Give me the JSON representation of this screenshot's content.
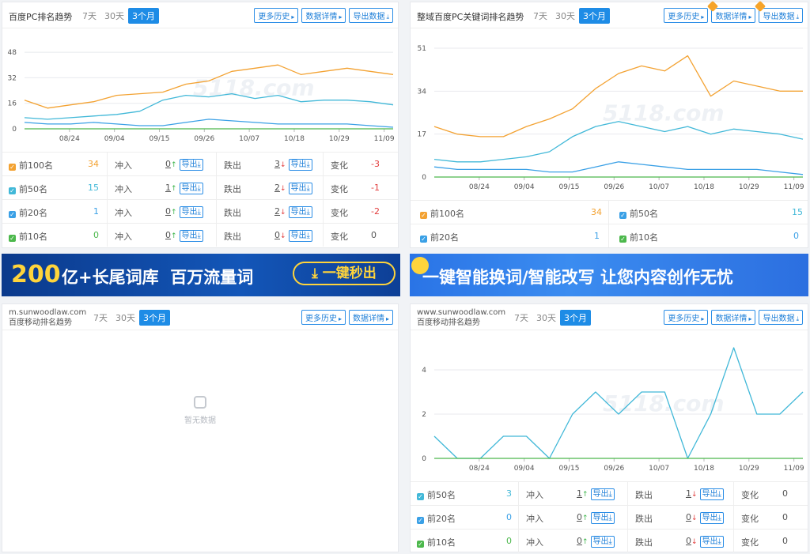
{
  "tabs": [
    "7天",
    "30天",
    "3个月"
  ],
  "head_buttons": [
    "更多历史",
    "数据详情",
    "导出数据"
  ],
  "export_label": "导出",
  "xticks": [
    "08/24",
    "09/04",
    "09/15",
    "09/26",
    "10/07",
    "10/18",
    "10/29",
    "11/09"
  ],
  "colors": {
    "orange": "#f3a232",
    "blue": "#3aa0e6",
    "cyan": "#41b8d8",
    "green": "#4cb84c",
    "accent": "#1e8ce6"
  },
  "panel1": {
    "title": "百度PC排名趋势",
    "yticks": [
      "0",
      "16",
      "32",
      "48"
    ],
    "rows": [
      {
        "label": "前100名",
        "value": "34",
        "in_label": "冲入",
        "in": "0",
        "out_label": "跌出",
        "out": "3",
        "chg_label": "变化",
        "chg": "-3"
      },
      {
        "label": "前50名",
        "value": "15",
        "in_label": "冲入",
        "in": "1",
        "out_label": "跌出",
        "out": "2",
        "chg_label": "变化",
        "chg": "-1"
      },
      {
        "label": "前20名",
        "value": "1",
        "in_label": "冲入",
        "in": "0",
        "out_label": "跌出",
        "out": "2",
        "chg_label": "变化",
        "chg": "-2"
      },
      {
        "label": "前10名",
        "value": "0",
        "in_label": "冲入",
        "in": "0",
        "out_label": "跌出",
        "out": "0",
        "chg_label": "变化",
        "chg": "0"
      }
    ]
  },
  "panel2": {
    "title": "整域百度PC关键词排名趋势",
    "yticks": [
      "0",
      "17",
      "34",
      "51"
    ],
    "stats": [
      {
        "label": "前100名",
        "value": "34"
      },
      {
        "label": "前50名",
        "value": "15"
      },
      {
        "label": "前20名",
        "value": "1"
      },
      {
        "label": "前10名",
        "value": "0"
      }
    ]
  },
  "banner1": {
    "num": "200",
    "text": "亿+长尾词库  百万流量词",
    "btn": "一键秒出"
  },
  "banner2": {
    "text": "一键智能换词/智能改写 让您内容创作无忧"
  },
  "panel3": {
    "domain": "m.sunwoodlaw.com",
    "subtitle": "百度移动排名趋势",
    "nodata": "暂无数据"
  },
  "panel4": {
    "domain": "www.sunwoodlaw.com",
    "subtitle": "百度移动排名趋势",
    "yticks": [
      "0",
      "2",
      "4"
    ],
    "rows": [
      {
        "label": "前50名",
        "value": "3",
        "in_label": "冲入",
        "in": "1",
        "out_label": "跌出",
        "out": "1",
        "chg_label": "变化",
        "chg": "0"
      },
      {
        "label": "前20名",
        "value": "0",
        "in_label": "冲入",
        "in": "0",
        "out_label": "跌出",
        "out": "0",
        "chg_label": "变化",
        "chg": "0"
      },
      {
        "label": "前10名",
        "value": "0",
        "in_label": "冲入",
        "in": "0",
        "out_label": "跌出",
        "out": "0",
        "chg_label": "变化",
        "chg": "0"
      }
    ]
  },
  "chart_data": [
    {
      "type": "line",
      "x": [
        "08/14",
        "08/19",
        "08/24",
        "08/29",
        "09/04",
        "09/09",
        "09/15",
        "09/20",
        "09/26",
        "10/01",
        "10/07",
        "10/12",
        "10/18",
        "10/23",
        "10/29",
        "11/03",
        "11/09"
      ],
      "ylim": [
        0,
        52
      ],
      "series": [
        {
          "color": "#f3a232",
          "values": [
            18,
            13,
            15,
            17,
            21,
            22,
            23,
            28,
            30,
            36,
            38,
            40,
            34,
            36,
            38,
            36,
            34
          ]
        },
        {
          "color": "#41b8d8",
          "values": [
            7,
            6,
            7,
            8,
            9,
            11,
            18,
            21,
            20,
            22,
            19,
            21,
            17,
            18,
            18,
            17,
            15
          ]
        },
        {
          "color": "#3aa0e6",
          "values": [
            4,
            3,
            3,
            4,
            3,
            2,
            2,
            4,
            6,
            5,
            4,
            3,
            3,
            3,
            3,
            2,
            1
          ]
        },
        {
          "color": "#4cb84c",
          "values": [
            0,
            0,
            0,
            0,
            0,
            0,
            0,
            0,
            0,
            0,
            0,
            0,
            0,
            0,
            0,
            0,
            0
          ]
        }
      ]
    },
    {
      "type": "line",
      "x": [
        "08/14",
        "08/19",
        "08/24",
        "08/29",
        "09/04",
        "09/09",
        "09/15",
        "09/20",
        "09/26",
        "10/01",
        "10/07",
        "10/12",
        "10/18",
        "10/23",
        "10/29",
        "11/03",
        "11/09"
      ],
      "ylim": [
        0,
        51
      ],
      "series": [
        {
          "color": "#f3a232",
          "values": [
            20,
            17,
            16,
            16,
            20,
            23,
            27,
            35,
            41,
            44,
            42,
            48,
            32,
            38,
            36,
            34,
            34
          ]
        },
        {
          "color": "#41b8d8",
          "values": [
            7,
            6,
            6,
            7,
            8,
            10,
            16,
            20,
            22,
            20,
            18,
            20,
            17,
            19,
            18,
            17,
            15
          ]
        },
        {
          "color": "#3aa0e6",
          "values": [
            4,
            3,
            3,
            3,
            3,
            2,
            2,
            4,
            6,
            5,
            4,
            3,
            3,
            3,
            3,
            2,
            1
          ]
        },
        {
          "color": "#4cb84c",
          "values": [
            0,
            0,
            0,
            0,
            0,
            0,
            0,
            0,
            0,
            0,
            0,
            0,
            0,
            0,
            0,
            0,
            0
          ]
        }
      ]
    },
    {
      "type": "line",
      "x": [
        "08/14",
        "08/19",
        "08/24",
        "08/29",
        "09/04",
        "09/09",
        "09/15",
        "09/20",
        "09/26",
        "10/01",
        "10/07",
        "10/12",
        "10/18",
        "10/23",
        "10/29",
        "11/03",
        "11/09"
      ],
      "ylim": [
        0,
        5
      ],
      "series": [
        {
          "color": "#41b8d8",
          "values": [
            1,
            0,
            0,
            1,
            1,
            0,
            2,
            3,
            2,
            3,
            3,
            0,
            2,
            5,
            2,
            2,
            3
          ]
        },
        {
          "color": "#4cb84c",
          "values": [
            0,
            0,
            0,
            0,
            0,
            0,
            0,
            0,
            0,
            0,
            0,
            0,
            0,
            0,
            0,
            0,
            0
          ]
        }
      ]
    }
  ]
}
